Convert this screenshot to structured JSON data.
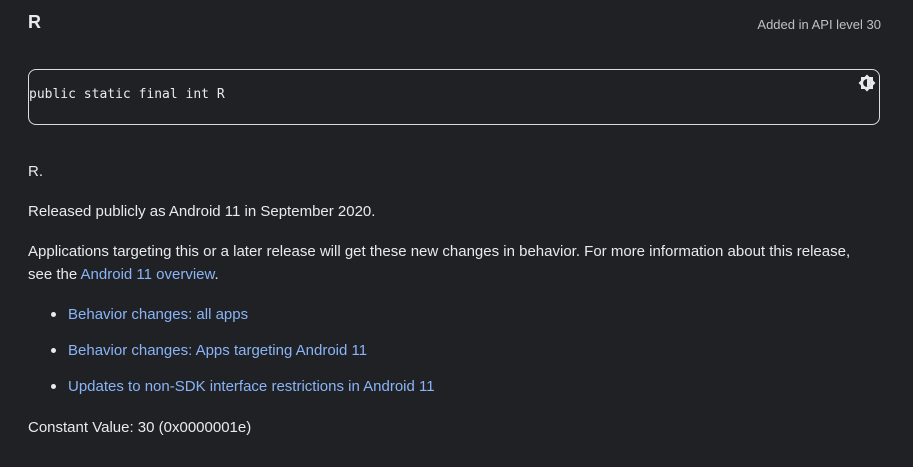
{
  "header": {
    "title": "R",
    "api_level": "Added in API level 30"
  },
  "code": {
    "signature": "public static final int R",
    "theme_icon": "brightness-icon"
  },
  "content": {
    "short_desc": "R.",
    "released": "Released publicly as Android 11 in September 2020.",
    "apps_text_before": "Applications targeting this or a later release will get these new changes in behavior. For more information about this release, see the ",
    "apps_link": "Android 11 overview",
    "apps_text_after": ".",
    "links": [
      {
        "label": "Behavior changes: all apps"
      },
      {
        "label": "Behavior changes: Apps targeting Android 11"
      },
      {
        "label": "Updates to non-SDK interface restrictions in Android 11"
      }
    ],
    "constant_value": "Constant Value: 30 (0x0000001e)"
  },
  "colors": {
    "background": "#202124",
    "text": "#e8eaed",
    "link": "#8ab4f8",
    "border": "#dadce0"
  }
}
